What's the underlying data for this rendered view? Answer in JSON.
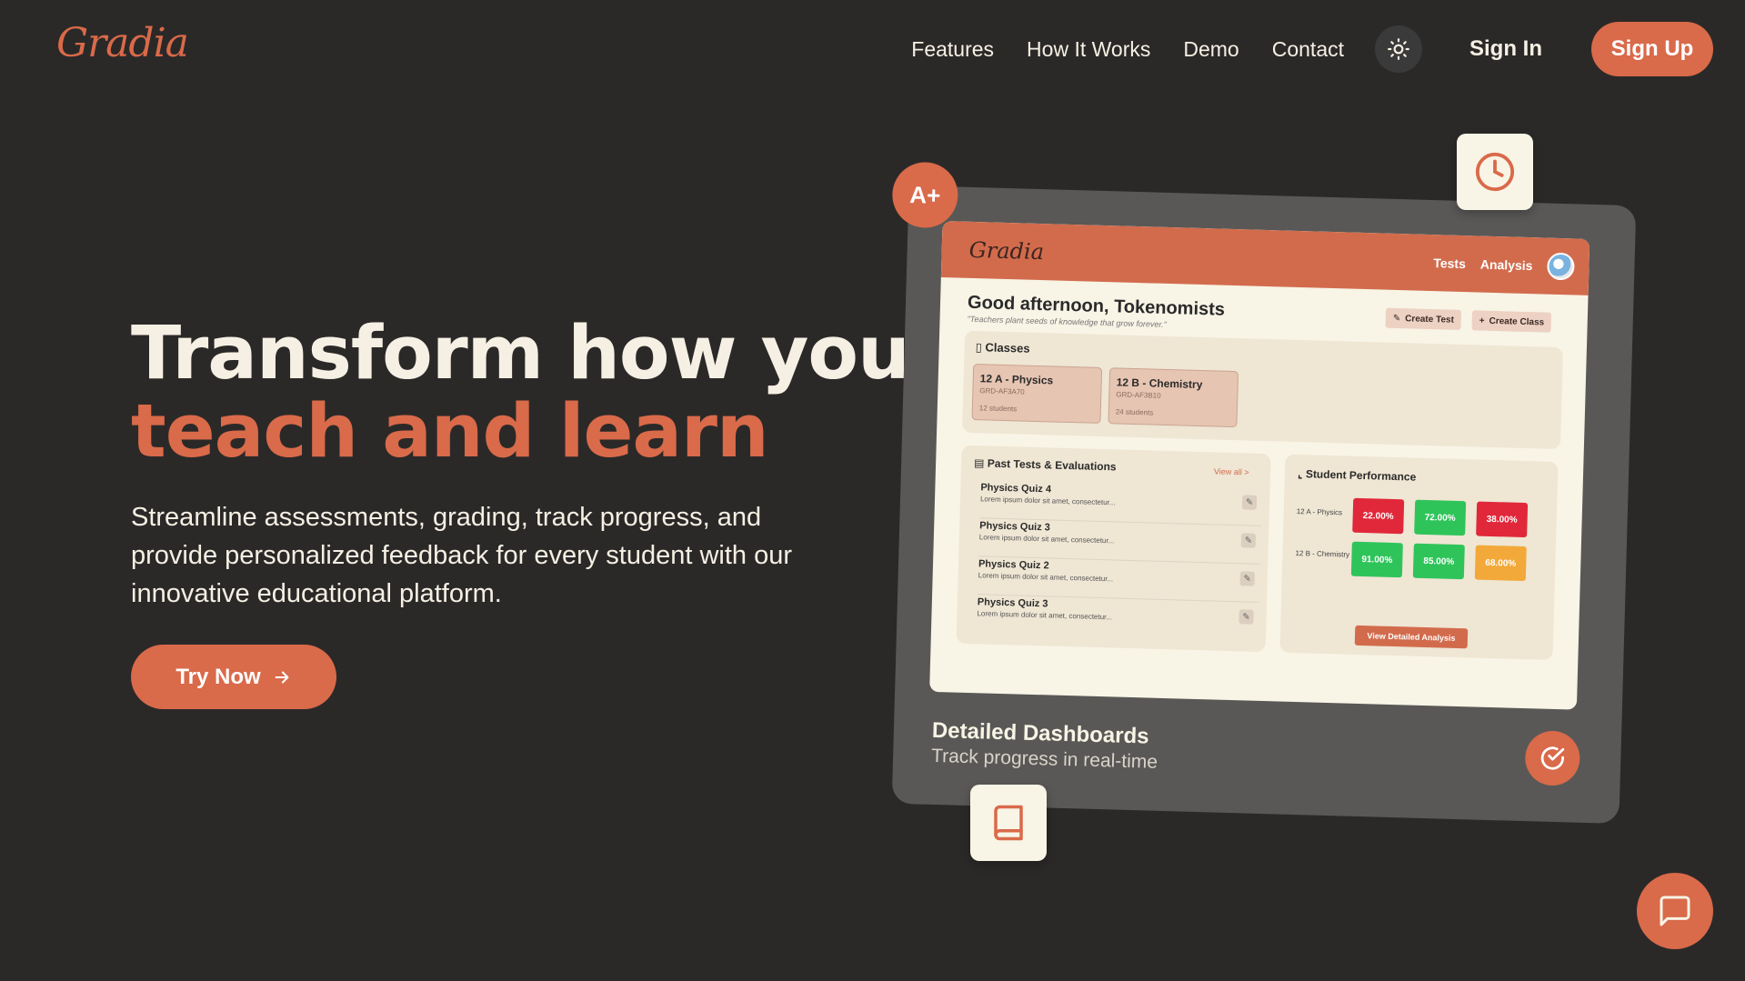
{
  "brand": {
    "logo_text": "Gradia",
    "accent": "#d96a4a",
    "bg": "#2b2928"
  },
  "nav": {
    "links": [
      "Features",
      "How It Works",
      "Demo",
      "Contact"
    ],
    "theme_icon": "sun-icon",
    "sign_in": "Sign In",
    "sign_up": "Sign Up"
  },
  "hero": {
    "title_line1": "Transform how you",
    "title_line2": "teach and learn",
    "description": "Streamline assessments, grading, track progress, and provide personalized feedback for every student with our innovative educational platform.",
    "cta": "Try Now"
  },
  "mockup": {
    "badge": "A+",
    "app_logo": "Gradia",
    "app_nav": [
      "Tests",
      "Analysis"
    ],
    "greeting": "Good afternoon, Tokenomists",
    "quote": "\"Teachers plant seeds of knowledge that grow forever.\"",
    "create_test": "Create Test",
    "create_class": "Create Class",
    "classes_title": "Classes",
    "classes": [
      {
        "name": "12 A - Physics",
        "code": "GRD-AF3A70",
        "students": "12 students"
      },
      {
        "name": "12 B - Chemistry",
        "code": "GRD-AF3B10",
        "students": "24 students"
      }
    ],
    "tests_title": "Past Tests & Evaluations",
    "view_all": "View all >",
    "tests": [
      {
        "name": "Physics Quiz 4",
        "desc": "Lorem ipsum dolor sit amet, consectetur..."
      },
      {
        "name": "Physics Quiz 3",
        "desc": "Lorem ipsum dolor sit amet, consectetur..."
      },
      {
        "name": "Physics Quiz 2",
        "desc": "Lorem ipsum dolor sit amet, consectetur..."
      },
      {
        "name": "Physics Quiz 3",
        "desc": "Lorem ipsum dolor sit amet, consectetur..."
      }
    ],
    "perf_title": "Student Performance",
    "perf_rows": [
      {
        "label": "12 A - Physics",
        "grades": [
          "22.00%",
          "72.00%",
          "38.00%"
        ]
      },
      {
        "label": "12 B - Chemistry",
        "grades": [
          "91.00%",
          "85.00%",
          "68.00%"
        ]
      }
    ],
    "view_analysis": "View Detailed Analysis",
    "caption_title": "Detailed Dashboards",
    "caption_sub": "Track progress in real-time"
  }
}
